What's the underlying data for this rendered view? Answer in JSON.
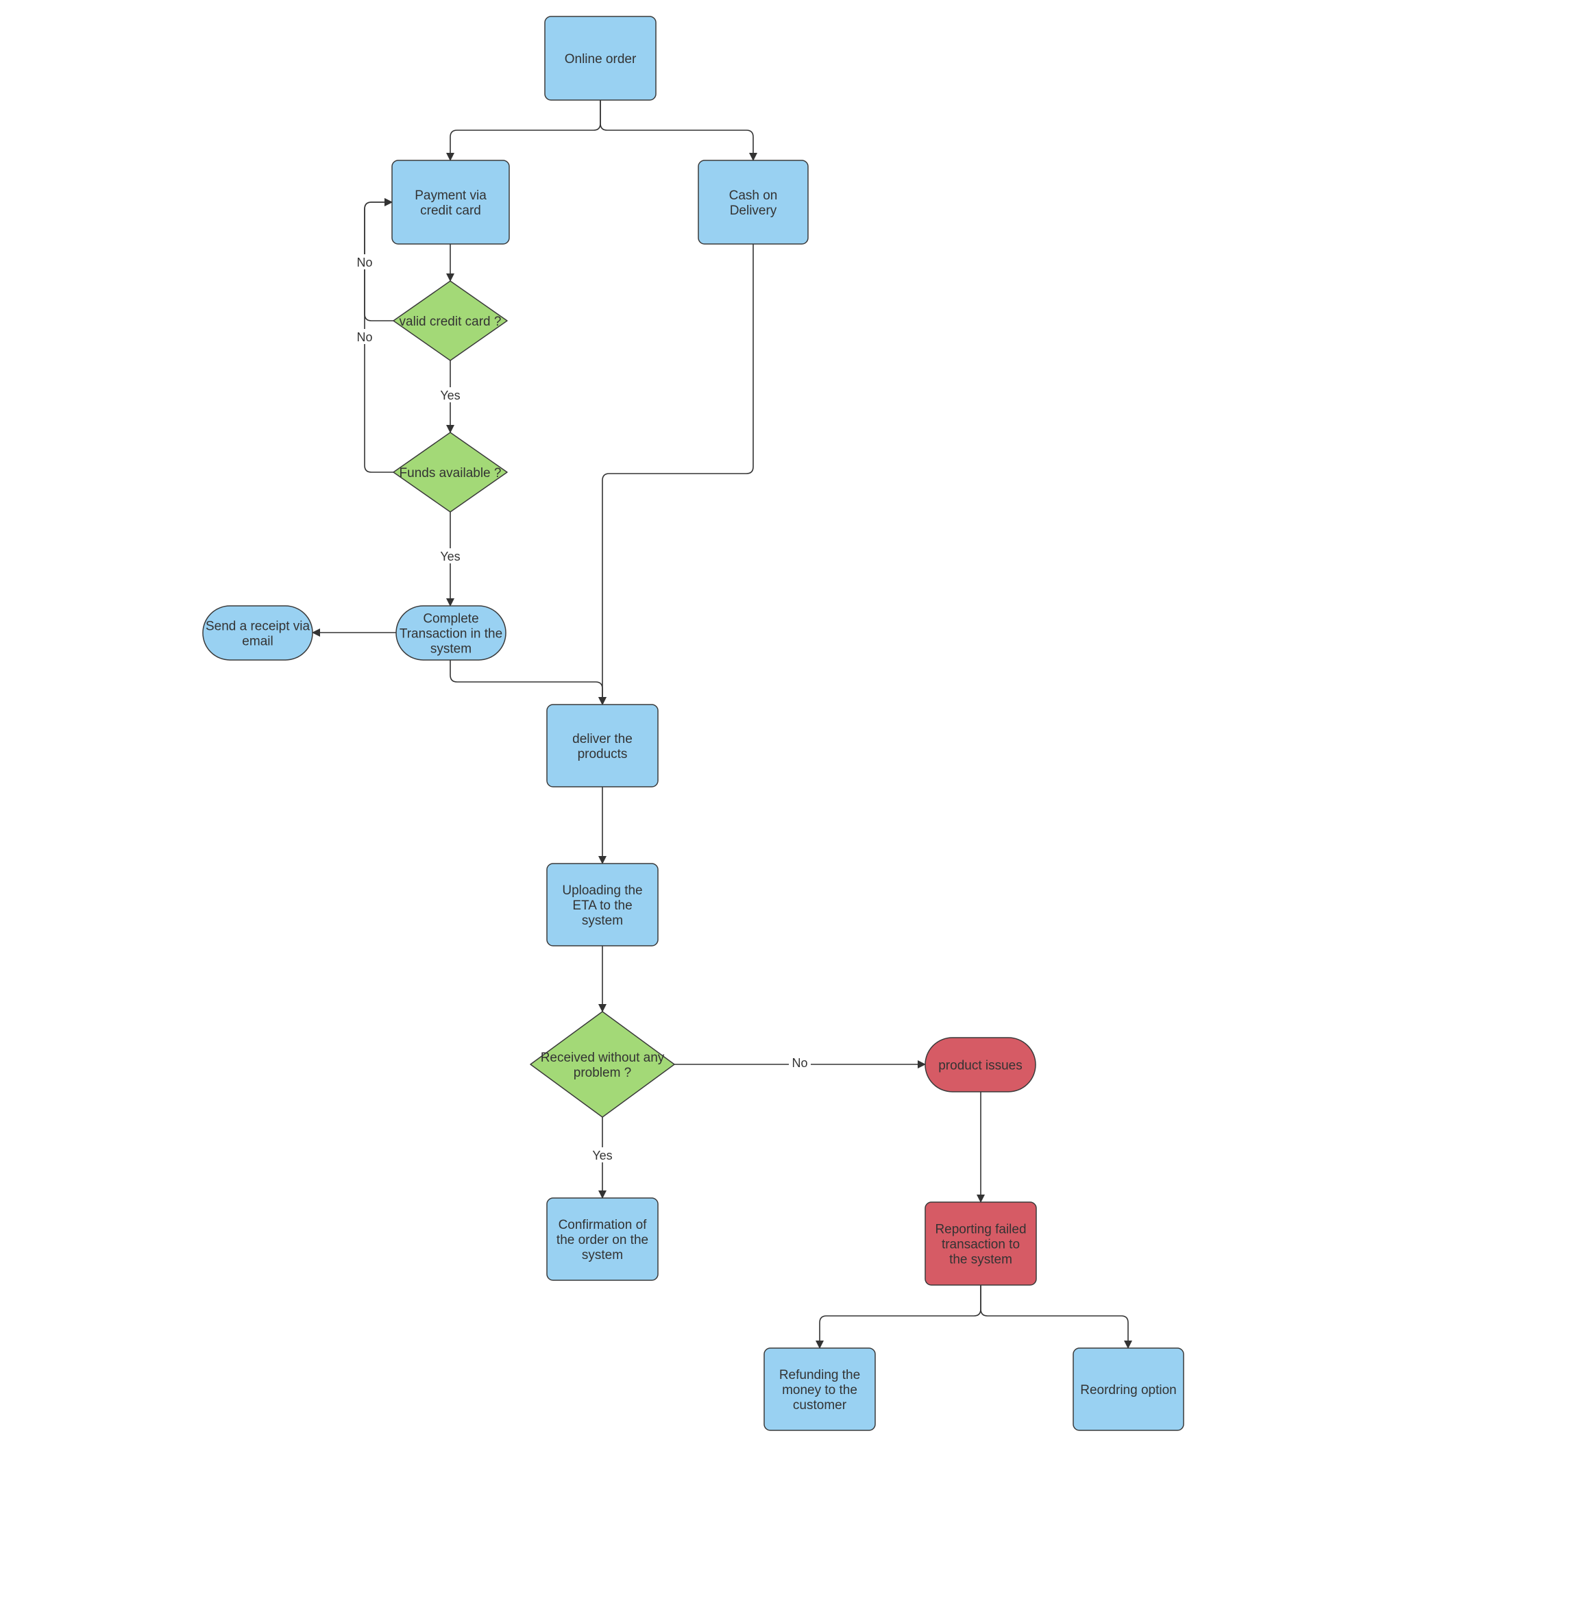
{
  "diagram": {
    "type": "flowchart",
    "colors": {
      "process": "#99d1f2",
      "decision": "#a3d977",
      "error": "#d65b65",
      "stroke": "#333333",
      "background": "#ffffff"
    },
    "nodes": [
      {
        "id": "online_order",
        "shape": "rounded-rect",
        "style": "process",
        "lines": [
          "Online order"
        ]
      },
      {
        "id": "payment_cc",
        "shape": "rounded-rect",
        "style": "process",
        "lines": [
          "Payment via",
          "credit card"
        ]
      },
      {
        "id": "cash_on_delivery",
        "shape": "rounded-rect",
        "style": "process",
        "lines": [
          "Cash on",
          "Delivery"
        ]
      },
      {
        "id": "valid_cc",
        "shape": "diamond",
        "style": "decision",
        "lines": [
          "valid credit card ?"
        ]
      },
      {
        "id": "funds_available",
        "shape": "diamond",
        "style": "decision",
        "lines": [
          "Funds available ?"
        ]
      },
      {
        "id": "complete_transaction",
        "shape": "stadium",
        "style": "process",
        "lines": [
          "Complete",
          "Transaction in the",
          "system"
        ]
      },
      {
        "id": "send_receipt",
        "shape": "stadium",
        "style": "process",
        "lines": [
          "Send a receipt via",
          "email"
        ]
      },
      {
        "id": "deliver_products",
        "shape": "rounded-rect",
        "style": "process",
        "lines": [
          "deliver the",
          "products"
        ]
      },
      {
        "id": "upload_eta",
        "shape": "rounded-rect",
        "style": "process",
        "lines": [
          "Uploading the",
          "ETA to the",
          "system"
        ]
      },
      {
        "id": "received_ok",
        "shape": "diamond",
        "style": "decision",
        "lines": [
          "Received without any",
          "problem ?"
        ]
      },
      {
        "id": "product_issues",
        "shape": "stadium",
        "style": "error",
        "lines": [
          "product issues"
        ]
      },
      {
        "id": "confirmation",
        "shape": "rounded-rect",
        "style": "process",
        "lines": [
          "Confirmation of",
          "the order on the",
          "system"
        ]
      },
      {
        "id": "report_failed",
        "shape": "rounded-rect",
        "style": "error",
        "lines": [
          "Reporting failed",
          "transaction to",
          "the system"
        ]
      },
      {
        "id": "refunding",
        "shape": "rounded-rect",
        "style": "process",
        "lines": [
          "Refunding the",
          "money to the",
          "customer"
        ]
      },
      {
        "id": "reordering",
        "shape": "rounded-rect",
        "style": "process",
        "lines": [
          "Reordring option"
        ]
      }
    ],
    "edges": [
      {
        "from": "online_order",
        "to": "payment_cc",
        "label": ""
      },
      {
        "from": "online_order",
        "to": "cash_on_delivery",
        "label": ""
      },
      {
        "from": "payment_cc",
        "to": "valid_cc",
        "label": ""
      },
      {
        "from": "valid_cc",
        "to": "payment_cc",
        "label": "No"
      },
      {
        "from": "valid_cc",
        "to": "funds_available",
        "label": "Yes"
      },
      {
        "from": "funds_available",
        "to": "payment_cc",
        "label": "No"
      },
      {
        "from": "funds_available",
        "to": "complete_transaction",
        "label": "Yes"
      },
      {
        "from": "complete_transaction",
        "to": "send_receipt",
        "label": ""
      },
      {
        "from": "complete_transaction",
        "to": "deliver_products",
        "label": ""
      },
      {
        "from": "cash_on_delivery",
        "to": "deliver_products",
        "label": ""
      },
      {
        "from": "deliver_products",
        "to": "upload_eta",
        "label": ""
      },
      {
        "from": "upload_eta",
        "to": "received_ok",
        "label": ""
      },
      {
        "from": "received_ok",
        "to": "product_issues",
        "label": "No"
      },
      {
        "from": "received_ok",
        "to": "confirmation",
        "label": "Yes"
      },
      {
        "from": "product_issues",
        "to": "report_failed",
        "label": ""
      },
      {
        "from": "report_failed",
        "to": "refunding",
        "label": ""
      },
      {
        "from": "report_failed",
        "to": "reordering",
        "label": ""
      }
    ]
  }
}
